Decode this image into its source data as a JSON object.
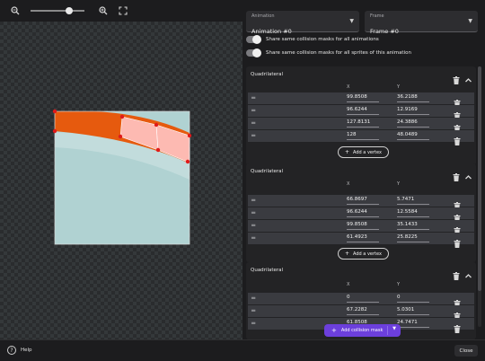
{
  "toolbar": {
    "zoom_out_icon": "zoom-out-icon",
    "zoom_in_icon": "zoom-in-icon",
    "fit_icon": "fullscreen-icon",
    "zoom_level": 0.72
  },
  "animation_select": {
    "label": "Animation",
    "value": "Animation #0"
  },
  "frame_select": {
    "label": "Frame",
    "value": "Frame #0"
  },
  "toggles": [
    {
      "label": "Share same collision masks for all animations",
      "on": false
    },
    {
      "label": "Share same collision masks for all sprites of this animation",
      "on": false
    }
  ],
  "columns": {
    "x": "X",
    "y": "Y"
  },
  "add_vertex_label": "Add a vertex",
  "masks": [
    {
      "title": "Quadrilateral",
      "vertices": [
        {
          "x": "99.8508",
          "y": "36.2188"
        },
        {
          "x": "96.6244",
          "y": "12.9169"
        },
        {
          "x": "127.8131",
          "y": "24.3886"
        },
        {
          "x": "128",
          "y": "48.0489"
        }
      ]
    },
    {
      "title": "Quadrilateral",
      "vertices": [
        {
          "x": "66.8697",
          "y": "5.7471"
        },
        {
          "x": "96.6244",
          "y": "12.5584"
        },
        {
          "x": "99.8508",
          "y": "35.1433"
        },
        {
          "x": "61.4923",
          "y": "25.8225"
        }
      ]
    },
    {
      "title": "Quadrilateral",
      "vertices": [
        {
          "x": "0",
          "y": "0"
        },
        {
          "x": "67.2282",
          "y": "5.0301"
        },
        {
          "x": "61.8508",
          "y": "24.7471"
        }
      ]
    }
  ],
  "footer": {
    "help_label": "Help",
    "add_mask_label": "Add collision mask",
    "close_label": "Close"
  },
  "colors": {
    "accent": "#6c3fdc",
    "mask_fill": "#ffc4c4",
    "vertex": "#e01a1a",
    "sprite_orange": "#e65a0e",
    "sprite_body": "#a9cfcf"
  }
}
